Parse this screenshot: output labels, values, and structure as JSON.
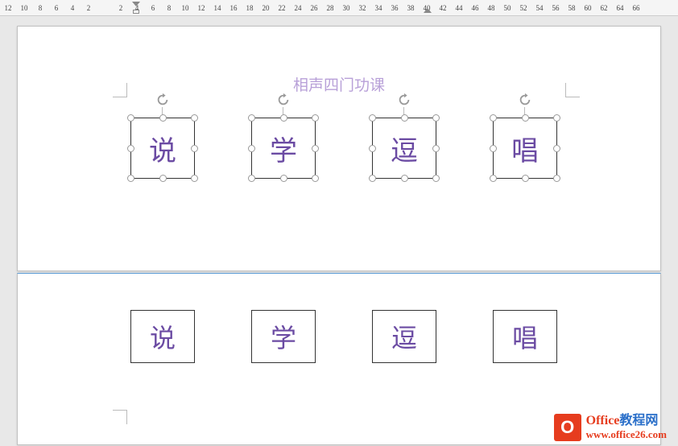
{
  "ruler": {
    "numbers": [
      "12",
      "10",
      "8",
      "6",
      "4",
      "2",
      "",
      "2",
      "4",
      "6",
      "8",
      "10",
      "12",
      "14",
      "16",
      "18",
      "20",
      "22",
      "24",
      "26",
      "28",
      "30",
      "32",
      "34",
      "36",
      "38",
      "40",
      "42",
      "44",
      "46",
      "48",
      "50",
      "52",
      "54",
      "56",
      "58",
      "60",
      "62",
      "64",
      "66"
    ]
  },
  "document": {
    "title": "相声四门功课",
    "boxes_selected": [
      "说",
      "学",
      "逗",
      "唱"
    ],
    "boxes_plain": [
      "说",
      "学",
      "逗",
      "唱"
    ]
  },
  "watermark": {
    "icon_letter": "O",
    "line1_a": "Office",
    "line1_b": "教程网",
    "line2": "www.office26.com"
  }
}
